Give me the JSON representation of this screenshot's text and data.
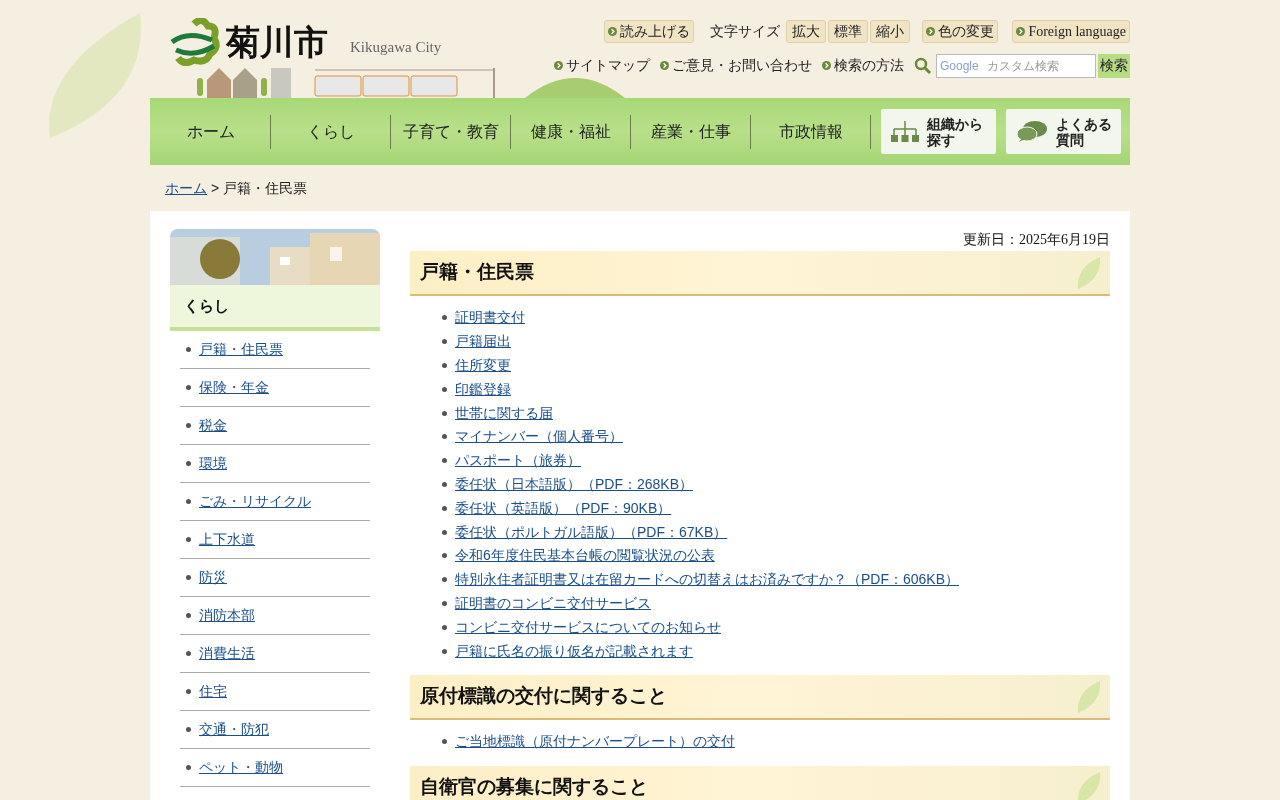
{
  "header": {
    "logo_text": "菊川市",
    "logo_subtitle": "Kikugawa City",
    "tools": [
      {
        "kind": "button",
        "label": "読み上げる"
      },
      {
        "kind": "label",
        "label": "文字サイズ"
      },
      {
        "kind": "plain",
        "label": "拡大"
      },
      {
        "kind": "plain",
        "label": "標準"
      },
      {
        "kind": "plain",
        "label": "縮小"
      },
      {
        "kind": "button",
        "label": "色の変更"
      },
      {
        "kind": "button",
        "label": "Foreign language"
      }
    ],
    "links": [
      "サイトマップ",
      "ご意見・お問い合わせ",
      "検索の方法"
    ],
    "search": {
      "placeholder": "カスタム検索",
      "brand": "Google",
      "button": "検索"
    }
  },
  "nav": [
    {
      "kind": "text",
      "label": "ホーム"
    },
    {
      "kind": "text",
      "label": "くらし"
    },
    {
      "kind": "text",
      "label": "子育て・教育"
    },
    {
      "kind": "text",
      "label": "健康・福祉"
    },
    {
      "kind": "text",
      "label": "産業・仕事"
    },
    {
      "kind": "text",
      "label": "市政情報"
    },
    {
      "kind": "org",
      "lines": [
        "組織から",
        "探す"
      ]
    },
    {
      "kind": "faq",
      "lines": [
        "よくある",
        "質問"
      ]
    }
  ],
  "breadcrumb": {
    "links": [
      "ホーム"
    ],
    "separator": ">",
    "current": "戸籍・住民票"
  },
  "sidebar": {
    "title": "くらし",
    "items": [
      {
        "label": "戸籍・住民票"
      },
      {
        "label": "保険・年金"
      },
      {
        "label": "税金"
      },
      {
        "label": "環境"
      },
      {
        "label": "ごみ・リサイクル"
      },
      {
        "label": "上下水道"
      },
      {
        "label": "防災"
      },
      {
        "label": "消防本部"
      },
      {
        "label": "消費生活"
      },
      {
        "label": "住宅"
      },
      {
        "label": "交通・防犯"
      },
      {
        "label": "ペット・動物"
      }
    ]
  },
  "updated": "更新日：2025年6月19日",
  "sections": [
    {
      "title": "戸籍・住民票",
      "links": [
        "証明書交付",
        "戸籍届出",
        "住所変更",
        "印鑑登録",
        "世帯に関する届",
        "マイナンバー（個人番号）",
        "パスポート（旅券）",
        "委任状（日本語版）（PDF：268KB）",
        "委任状（英語版）（PDF：90KB）",
        "委任状（ポルトガル語版）（PDF：67KB）",
        "令和6年度住民基本台帳の閲覧状況の公表",
        "特別永住者証明書又は在留カードへの切替えはお済みですか？（PDF：606KB）",
        "証明書のコンビニ交付サービス",
        "コンビニ交付サービスについてのお知らせ",
        "戸籍に氏名の振り仮名が記載されます"
      ]
    },
    {
      "title": "原付標識の交付に関すること",
      "links": [
        "ご当地標識（原付ナンバープレート）の交付"
      ]
    },
    {
      "title": "自衛官の募集に関すること"
    }
  ]
}
